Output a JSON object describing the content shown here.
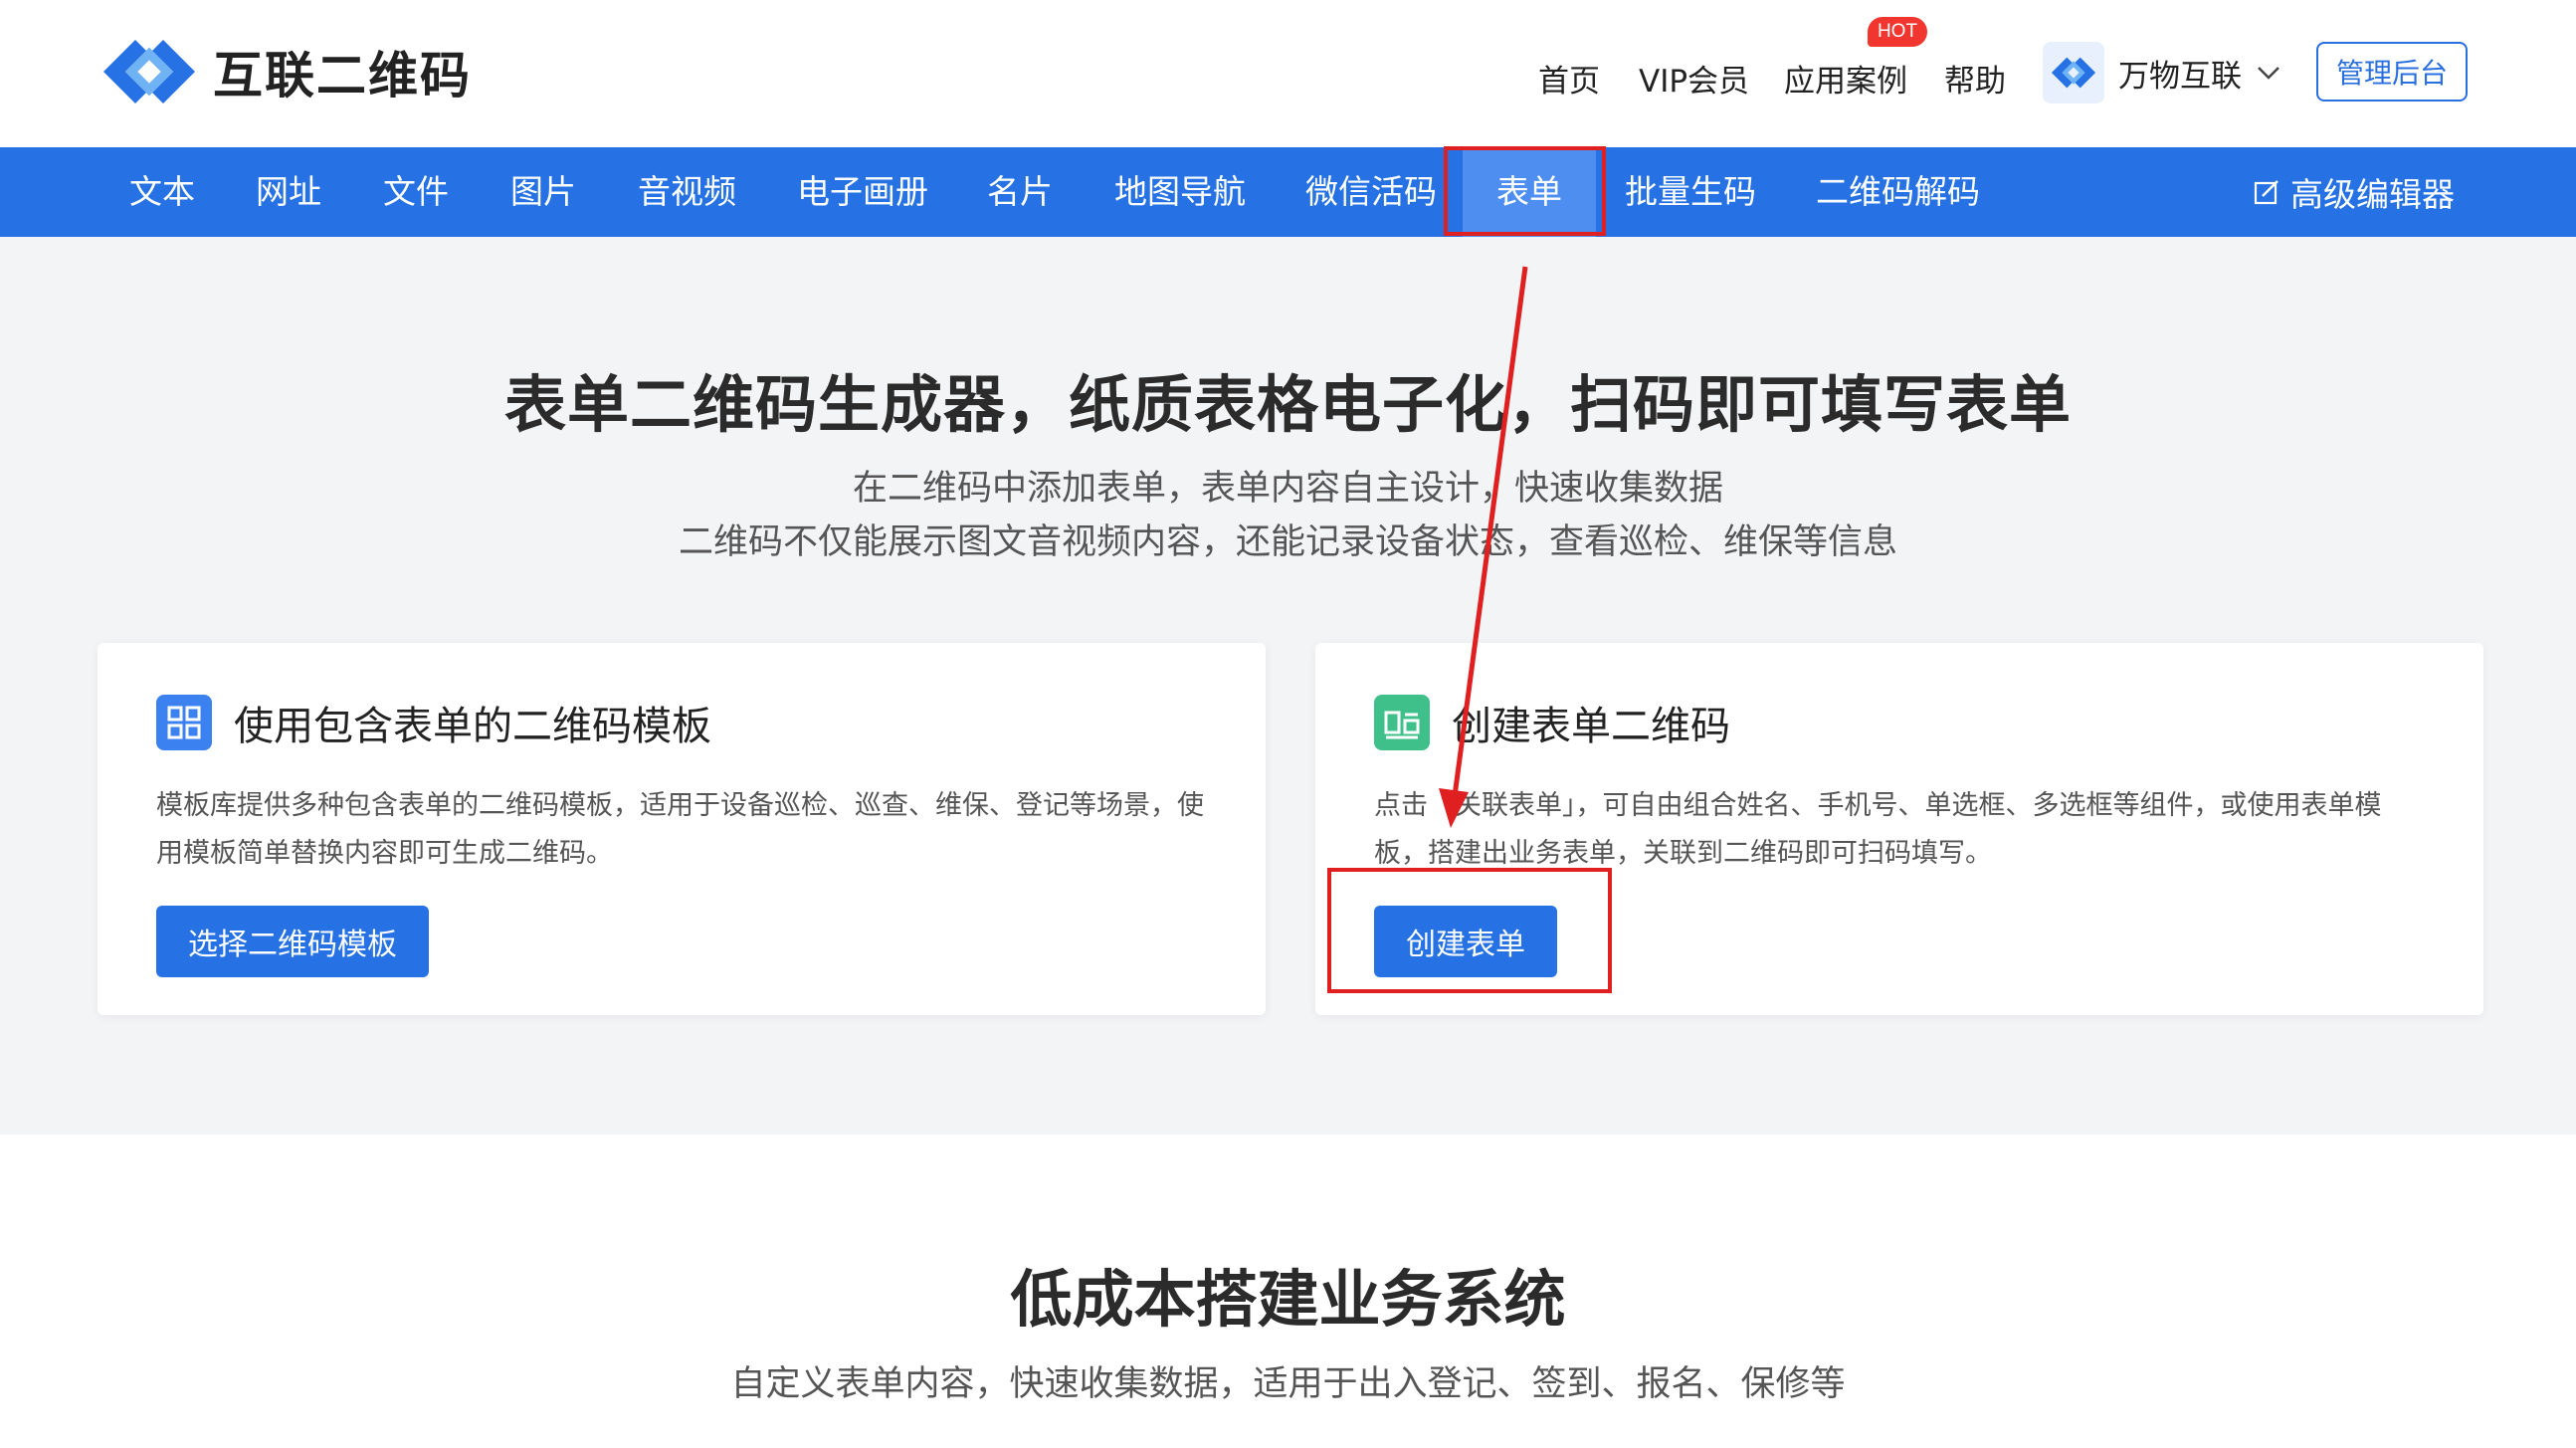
{
  "header": {
    "brand": "互联二维码",
    "links": [
      "首页",
      "VIP会员",
      "应用案例",
      "帮助"
    ],
    "hot_badge": "HOT",
    "org_switch": "万物互联",
    "admin_button": "管理后台"
  },
  "nav": {
    "items": [
      "文本",
      "网址",
      "文件",
      "图片",
      "音视频",
      "电子画册",
      "名片",
      "地图导航",
      "微信活码",
      "表单",
      "批量生码",
      "二维码解码"
    ],
    "active": "表单",
    "advanced_editor": "高级编辑器"
  },
  "hero": {
    "title": "表单二维码生成器，纸质表格电子化，扫码即可填写表单",
    "subtitle_1": "在二维码中添加表单，表单内容自主设计，快速收集数据",
    "subtitle_2": "二维码不仅能展示图文音视频内容，还能记录设备状态，查看巡检、维保等信息"
  },
  "cards": [
    {
      "title": "使用包含表单的二维码模板",
      "desc": "模板库提供多种包含表单的二维码模板，适用于设备巡检、巡查、维保、登记等场景，使用模板简单替换内容即可生成二维码。",
      "button": "选择二维码模板"
    },
    {
      "title": "创建表单二维码",
      "desc": "点击「关联表单」，可自由组合姓名、手机号、单选框、多选框等组件，或使用表单模板，搭建出业务表单，关联到二维码即可扫码填写。",
      "button": "创建表单"
    }
  ],
  "lower": {
    "title": "低成本搭建业务系统",
    "subtitle": "自定义表单内容，快速收集数据，适用于出入登记、签到、报名、保修等"
  },
  "colors": {
    "primary": "#2672e4",
    "nav_active": "#4d8ef0",
    "annotation_red": "#e02020",
    "hot_red": "#f1362f",
    "hero_bg": "#f3f4f6"
  },
  "icons": {
    "logo": "qr-link-logo-icon",
    "template_card": "qr-grid-icon",
    "form_card": "form-layout-icon",
    "editor": "edit-icon",
    "dropdown": "chevron-down-icon"
  }
}
